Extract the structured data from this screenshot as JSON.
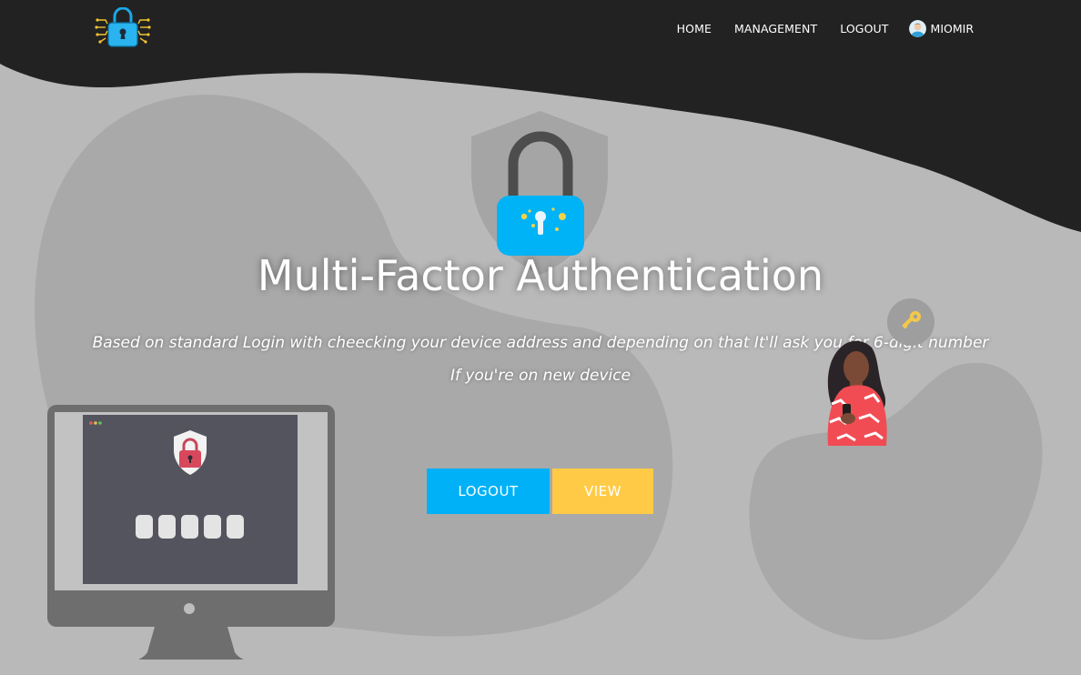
{
  "colors": {
    "header_dark": "#222222",
    "background": "#b9b9b9",
    "blob": "#a8a8a8",
    "accent_blue": "#00b1f7",
    "accent_yellow": "#ffcb47"
  },
  "nav": {
    "home": "HOME",
    "management": "MANAGEMENT",
    "logout": "LOGOUT",
    "user_name": "MIOMIR"
  },
  "hero": {
    "title": "Multi-Factor Authentication",
    "subtitle_line1": "Based on standard Login with cheecking your device address and depending on that It'll ask you for 6-digit number",
    "subtitle_line2": "If you're on new device"
  },
  "buttons": {
    "logout": "LOGOUT",
    "view": "VIEW"
  },
  "icons": {
    "logo": "padlock-circuit-logo-icon",
    "hero": "shield-padlock-icon",
    "avatar": "user-avatar-icon",
    "key": "key-icon",
    "monitor": "monitor-pin-entry-illustration",
    "person": "woman-with-phone-illustration"
  }
}
